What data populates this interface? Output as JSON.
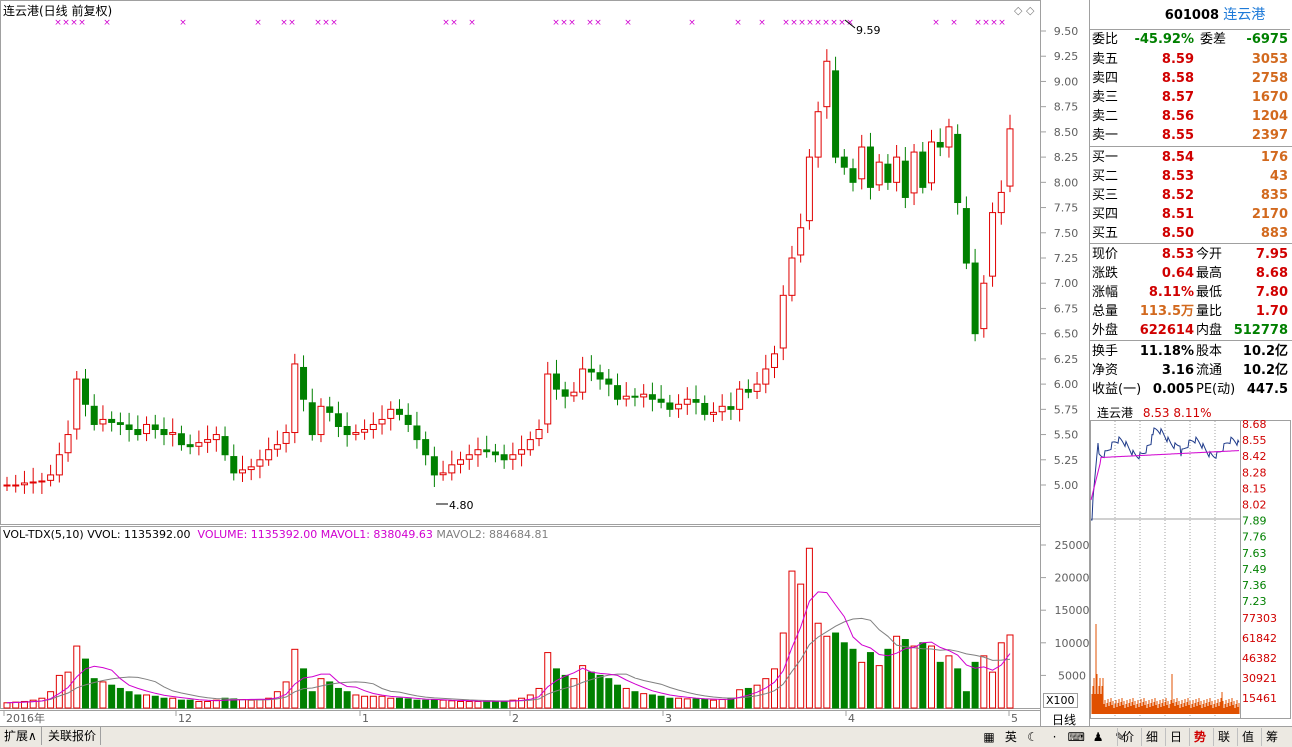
{
  "main_chart": {
    "title": "连云港(日线 前复权)",
    "high_marker": "9.59",
    "low_marker": "4.80",
    "price_ticks": [
      "9.50",
      "9.25",
      "9.00",
      "8.75",
      "8.50",
      "8.25",
      "8.00",
      "7.75",
      "7.50",
      "7.25",
      "7.00",
      "6.75",
      "6.50",
      "6.25",
      "6.00",
      "5.75",
      "5.50",
      "5.25",
      "5.00"
    ]
  },
  "vol_panel": {
    "label_name": "VOL-TDX(5,10)",
    "label_vvol": "VVOL: 1135392.00",
    "label_volume": "VOLUME: 1135392.00",
    "label_mavol1": "MAVOL1: 838049.63",
    "label_mavol2": "MAVOL2: 884684.81",
    "ticks": [
      "25000",
      "20000",
      "15000",
      "10000",
      "5000"
    ],
    "unit": "X100"
  },
  "x_axis": {
    "labels": [
      "2016年",
      "12",
      "1",
      "2",
      "3",
      "4",
      "5"
    ],
    "period": "日线"
  },
  "quote": {
    "code": "601008",
    "name": "连云港",
    "weibi_label": "委比",
    "weibi": "-45.92%",
    "weicha_label": "委差",
    "weicha": "-6975",
    "asks": [
      {
        "label": "卖五",
        "price": "8.59",
        "vol": "3053"
      },
      {
        "label": "卖四",
        "price": "8.58",
        "vol": "2758"
      },
      {
        "label": "卖三",
        "price": "8.57",
        "vol": "1670"
      },
      {
        "label": "卖二",
        "price": "8.56",
        "vol": "1204"
      },
      {
        "label": "卖一",
        "price": "8.55",
        "vol": "2397"
      }
    ],
    "bids": [
      {
        "label": "买一",
        "price": "8.54",
        "vol": "176"
      },
      {
        "label": "买二",
        "price": "8.53",
        "vol": "43"
      },
      {
        "label": "买三",
        "price": "8.52",
        "vol": "835"
      },
      {
        "label": "买四",
        "price": "8.51",
        "vol": "2170"
      },
      {
        "label": "买五",
        "price": "8.50",
        "vol": "883"
      }
    ],
    "stats": [
      {
        "l1": "现价",
        "v1": "8.53",
        "c1": "red",
        "l2": "今开",
        "v2": "7.95",
        "c2": "red"
      },
      {
        "l1": "涨跌",
        "v1": "0.64",
        "c1": "red",
        "l2": "最高",
        "v2": "8.68",
        "c2": "red"
      },
      {
        "l1": "涨幅",
        "v1": "8.11%",
        "c1": "red",
        "l2": "最低",
        "v2": "7.80",
        "c2": "red"
      },
      {
        "l1": "总量",
        "v1": "113.5万",
        "c1": "orange",
        "l2": "量比",
        "v2": "1.70",
        "c2": "red"
      },
      {
        "l1": "外盘",
        "v1": "622614",
        "c1": "red",
        "l2": "内盘",
        "v2": "512778",
        "c2": "green"
      }
    ],
    "stats2": [
      {
        "l1": "换手",
        "v1": "11.18%",
        "l2": "股本",
        "v2": "10.2亿"
      },
      {
        "l1": "净资",
        "v1": "3.16",
        "l2": "流通",
        "v2": "10.2亿"
      },
      {
        "l1": "收益(一)",
        "v1": "0.005",
        "l2": "PE(动)",
        "v2": "447.5"
      }
    ]
  },
  "intraday": {
    "name": "连云港",
    "price": "8.53",
    "pct": "8.11%",
    "price_ticks": [
      "8.68",
      "8.55",
      "8.42",
      "8.28",
      "8.15",
      "8.02",
      "7.89",
      "7.76",
      "7.63",
      "7.49",
      "7.36",
      "7.23"
    ],
    "vol_ticks": [
      "77303",
      "61842",
      "46382",
      "30921",
      "15461"
    ]
  },
  "bottom_tabs": [
    "扩展∧",
    "关联报价"
  ],
  "right_tabs": [
    "价",
    "细",
    "日",
    "势",
    "联",
    "值",
    "筹"
  ],
  "colors": {
    "up": "#e00000",
    "down": "#008000",
    "ma1": "#d000d0",
    "ma2": "#808080",
    "axis": "#e00000"
  }
}
